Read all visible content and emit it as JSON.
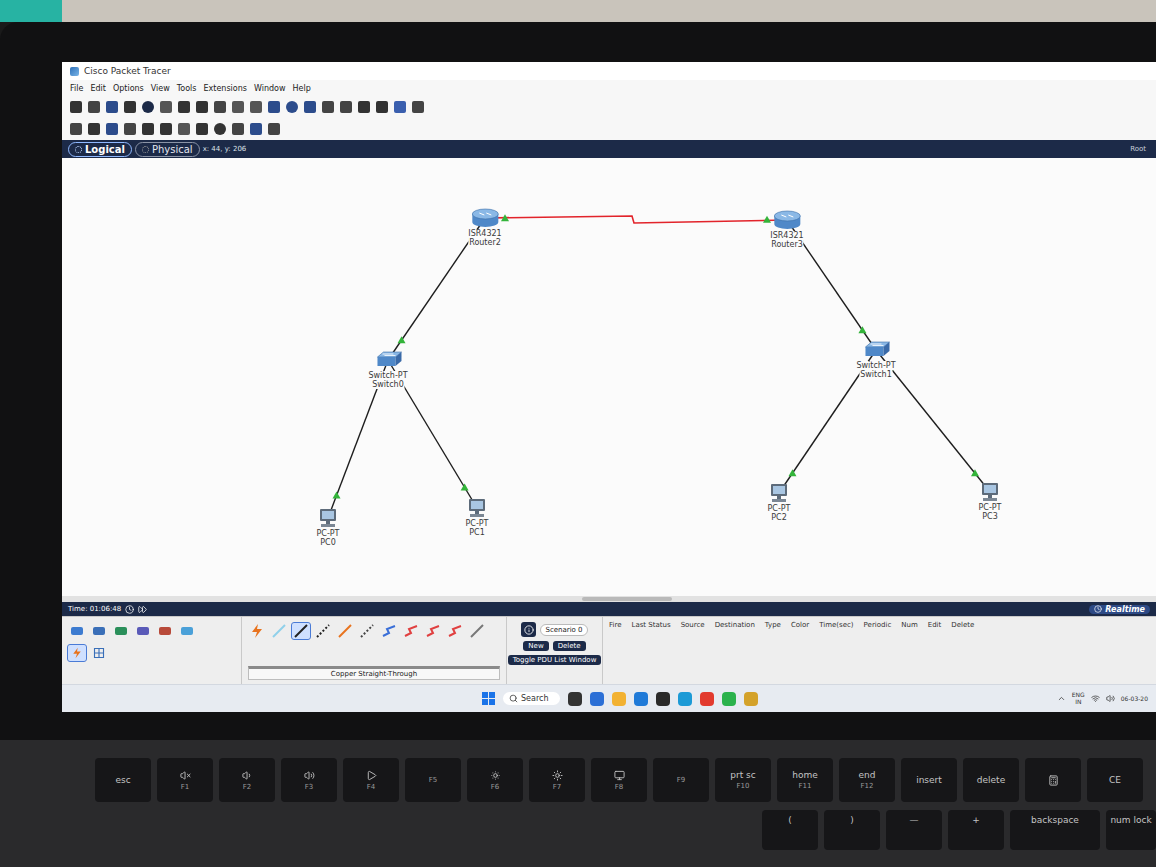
{
  "window": {
    "title": "Cisco Packet Tracer"
  },
  "menu": [
    "File",
    "Edit",
    "Options",
    "View",
    "Tools",
    "Extensions",
    "Window",
    "Help"
  ],
  "tabs": [
    {
      "label": "Logical",
      "selected": true
    },
    {
      "label": "Physical",
      "selected": false
    }
  ],
  "coords": "x: 44, y: 206",
  "corner": "Root",
  "nodes": [
    {
      "model": "ISR4321",
      "name": "Router2",
      "kind": "router"
    },
    {
      "model": "ISR4321",
      "name": "Router3",
      "kind": "router"
    },
    {
      "model": "Switch-PT",
      "name": "Switch0",
      "kind": "switch"
    },
    {
      "model": "Switch-PT",
      "name": "Switch1",
      "kind": "switch"
    },
    {
      "model": "PC-PT",
      "name": "PC0",
      "kind": "pc"
    },
    {
      "model": "PC-PT",
      "name": "PC1",
      "kind": "pc"
    },
    {
      "model": "PC-PT",
      "name": "PC2",
      "kind": "pc"
    },
    {
      "model": "PC-PT",
      "name": "PC3",
      "kind": "pc"
    }
  ],
  "links": [
    {
      "from": "Router2",
      "to": "Router3",
      "kind": "serial",
      "up": true
    },
    {
      "from": "Router2",
      "to": "Switch0",
      "kind": "copper",
      "up": true
    },
    {
      "from": "Router3",
      "to": "Switch1",
      "kind": "copper",
      "up": true
    },
    {
      "from": "Switch0",
      "to": "PC0",
      "kind": "copper",
      "up": true
    },
    {
      "from": "Switch0",
      "to": "PC1",
      "kind": "copper",
      "up": true
    },
    {
      "from": "Switch1",
      "to": "PC2",
      "kind": "copper",
      "up": true
    },
    {
      "from": "Switch1",
      "to": "PC3",
      "kind": "copper",
      "up": true
    }
  ],
  "time": "Time: 01:06:48",
  "mode": {
    "label": "Realtime",
    "selected": true
  },
  "categories": [
    {
      "kind": "router",
      "selected": false
    },
    {
      "kind": "switch",
      "selected": false
    },
    {
      "kind": "hub",
      "selected": false
    },
    {
      "kind": "wireless",
      "selected": false
    },
    {
      "kind": "security",
      "selected": false
    },
    {
      "kind": "cloud",
      "selected": false
    }
  ],
  "subcategories": [
    {
      "kind": "bolt",
      "selected": true
    },
    {
      "kind": "grid",
      "selected": false
    }
  ],
  "cables": [
    {
      "kind": "bolt",
      "color": "#e8731e",
      "selected": false
    },
    {
      "kind": "line",
      "color": "#8fd0ea",
      "selected": false
    },
    {
      "kind": "line",
      "color": "#222222",
      "selected": true
    },
    {
      "kind": "dashed",
      "color": "#222222",
      "selected": false
    },
    {
      "kind": "line",
      "color": "#e8731e",
      "selected": false
    },
    {
      "kind": "dashed",
      "color": "#444444",
      "selected": false
    },
    {
      "kind": "zig",
      "color": "#3a6fd8",
      "selected": false
    },
    {
      "kind": "zig",
      "color": "#e04040",
      "selected": false
    },
    {
      "kind": "zig",
      "color": "#e04040",
      "selected": false
    },
    {
      "kind": "zig",
      "color": "#e04040",
      "selected": false
    },
    {
      "kind": "line",
      "color": "#777777",
      "selected": false
    }
  ],
  "cable_label": "Copper Straight-Through",
  "scenario": "Scenario 0",
  "buttons": [
    "New",
    "Delete"
  ],
  "toggle": "Toggle PDU List Window",
  "pdu_columns": [
    "Fire",
    "Last Status",
    "Source",
    "Destination",
    "Type",
    "Color",
    "Time(sec)",
    "Periodic",
    "Num",
    "Edit",
    "Delete"
  ],
  "taskbar": {
    "search": "Search",
    "lang": "ENG",
    "region": "IN",
    "date": "06-03-20",
    "apps": [
      {
        "color": "#333333"
      },
      {
        "color": "#2b6fd6"
      },
      {
        "color": "#f2b233"
      },
      {
        "color": "#1f7ad8"
      },
      {
        "color": "#2a2a2a"
      },
      {
        "color": "#1c9ad6"
      },
      {
        "color": "#e23a2e"
      },
      {
        "color": "#2bb24c"
      },
      {
        "color": "#d4a22a"
      }
    ]
  },
  "keys_row1": [
    {
      "kind": "text",
      "label": "esc"
    },
    {
      "kind": "mute",
      "fn": "F1"
    },
    {
      "kind": "voldown",
      "fn": "F2"
    },
    {
      "kind": "volup",
      "fn": "F3"
    },
    {
      "kind": "play",
      "fn": "F4"
    },
    {
      "kind": "plain",
      "fn": "F5"
    },
    {
      "kind": "dimmer",
      "fn": "F6"
    },
    {
      "kind": "brighter",
      "fn": "F7"
    },
    {
      "kind": "project",
      "fn": "F8"
    },
    {
      "kind": "plain",
      "fn": "F9"
    },
    {
      "kind": "text",
      "label": "prt sc",
      "fn": "F10"
    },
    {
      "kind": "text",
      "label": "home",
      "fn": "F11"
    },
    {
      "kind": "text",
      "label": "end",
      "fn": "F12"
    },
    {
      "kind": "text",
      "label": "insert"
    },
    {
      "kind": "text",
      "label": "delete"
    },
    {
      "kind": "calc"
    },
    {
      "kind": "text",
      "label": "CE"
    }
  ],
  "keys_row2": [
    {
      "label": "("
    },
    {
      "label": ")"
    },
    {
      "label": "—"
    },
    {
      "label": "+"
    },
    {
      "label": "backspace"
    },
    {
      "label": "num lock"
    }
  ]
}
